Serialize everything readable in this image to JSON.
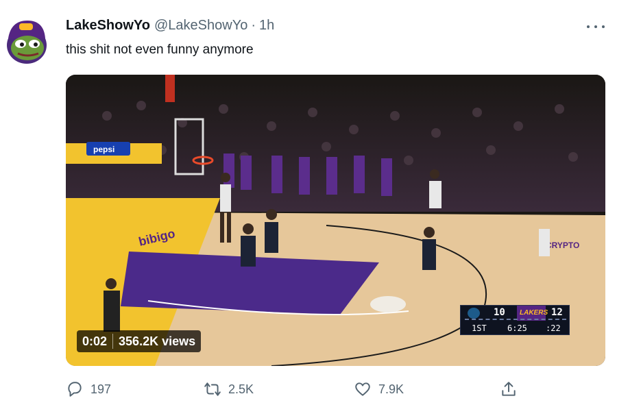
{
  "tweet": {
    "display_name": "LakeShowYo",
    "handle": "@LakeShowYo",
    "separator": "·",
    "time": "1h",
    "text": "this shit not even funny anymore",
    "avatar_icon": "pepe-frog-lakers-hat-avatar"
  },
  "media": {
    "elapsed": "0:02",
    "views": "356.2K views",
    "arena_ads": [
      "pepsi",
      "bibigo",
      "CRYPTO ARENA"
    ],
    "scorebug": {
      "away_score": "10",
      "home_logo": "LAKERS",
      "home_score": "12",
      "quarter": "1ST",
      "game_clock": "6:25",
      "shot_clock": ":22"
    }
  },
  "actions": {
    "reply_count": "197",
    "retweet_count": "2.5K",
    "like_count": "7.9K"
  },
  "colors": {
    "lakers_purple": "#552583",
    "lakers_gold": "#fdb927",
    "secondary_text": "#536471"
  }
}
